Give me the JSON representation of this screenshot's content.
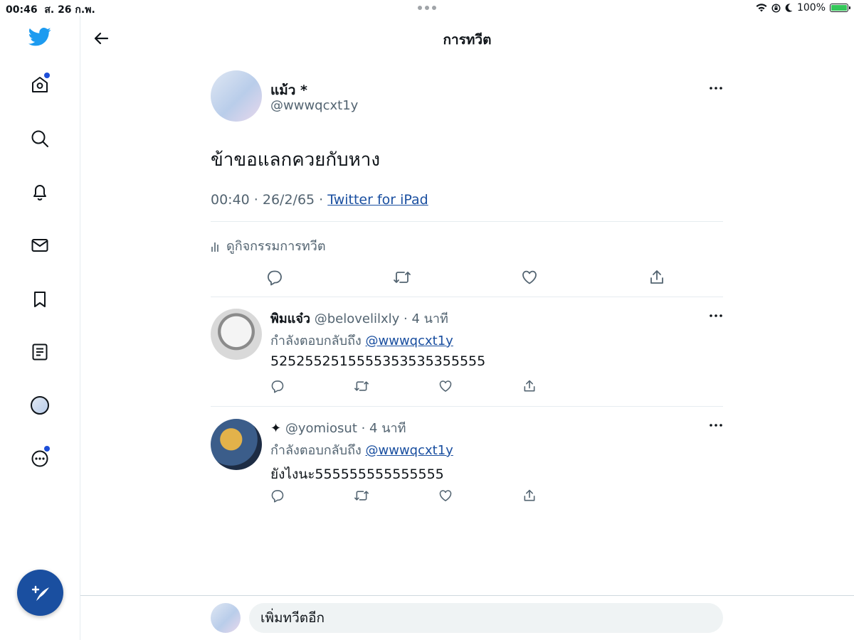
{
  "status_bar": {
    "time": "00:46",
    "date": "ส. 26 ก.พ.",
    "battery": "100%",
    "battery_level": 1.0
  },
  "header": {
    "title": "การทวีต"
  },
  "tweet": {
    "author_name": "แม้ว *",
    "author_handle": "@wwwqcxt1y",
    "text": "ข้าขอแลกควยกับหาง",
    "time": "00:40 · 26/2/65 · ",
    "source": "Twitter for iPad",
    "activity_label": "ดูกิจกรรมการทวีต"
  },
  "replies": [
    {
      "name": "พิมแจ๋ว",
      "handle_time": "@belovelilxly · 4 นาที",
      "replying_prefix": "กำลังตอบกลับถึง ",
      "mention": "@wwwqcxt1y",
      "text": "5252552515555353535355555"
    },
    {
      "name": "✦",
      "handle_time": "@yomiosut · 4 นาที",
      "replying_prefix": "กำลังตอบกลับถึง ",
      "mention": "@wwwqcxt1y",
      "text": "ยังไงนะ555555555555555"
    }
  ],
  "composer": {
    "placeholder": "เพิ่มทวีตอีก"
  },
  "icons": {
    "sidebar": [
      "twitter-logo-icon",
      "home-icon",
      "search-icon",
      "bell-icon",
      "mail-icon",
      "bookmark-icon",
      "lists-icon",
      "profile-icon",
      "more-icon"
    ],
    "compose": "compose-tweet-icon"
  },
  "colors": {
    "brand": "#1d9bf0",
    "accent": "#1a4fa0",
    "text": "#0f1419",
    "muted": "#536471"
  }
}
